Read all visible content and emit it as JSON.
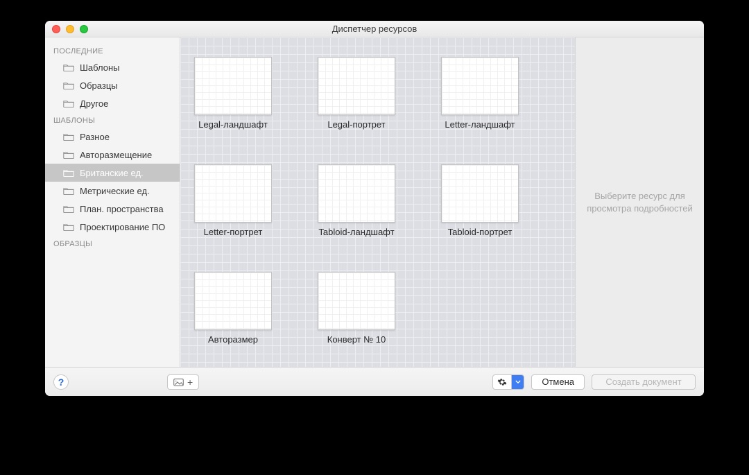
{
  "window": {
    "title": "Диспетчер ресурсов"
  },
  "sidebar": {
    "sections": [
      {
        "header": "ПОСЛЕДНИЕ",
        "items": [
          {
            "label": "Шаблоны",
            "selected": false
          },
          {
            "label": "Образцы",
            "selected": false
          },
          {
            "label": "Другое",
            "selected": false
          }
        ]
      },
      {
        "header": "ШАБЛОНЫ",
        "items": [
          {
            "label": "Разное",
            "selected": false
          },
          {
            "label": "Авторазмещение",
            "selected": false
          },
          {
            "label": "Британские ед.",
            "selected": true
          },
          {
            "label": "Метрические ед.",
            "selected": false
          },
          {
            "label": "План. пространства",
            "selected": false
          },
          {
            "label": "Проектирование ПО",
            "selected": false
          }
        ]
      },
      {
        "header": "ОБРАЗЦЫ",
        "items": []
      }
    ]
  },
  "templates": [
    {
      "label": "Legal-ландшафт"
    },
    {
      "label": "Legal-портрет"
    },
    {
      "label": "Letter-ландшафт"
    },
    {
      "label": "Letter-портрет"
    },
    {
      "label": "Tabloid-ландшафт"
    },
    {
      "label": "Tabloid-портрет"
    },
    {
      "label": "Авторазмер"
    },
    {
      "label": "Конверт № 10"
    }
  ],
  "details": {
    "placeholder": "Выберите ресурс для просмотра подробностей"
  },
  "footer": {
    "help": "?",
    "add_canvas": "+",
    "cancel": "Отмена",
    "create": "Создать документ"
  },
  "icons": {
    "gear": "✻",
    "plus": "+"
  }
}
